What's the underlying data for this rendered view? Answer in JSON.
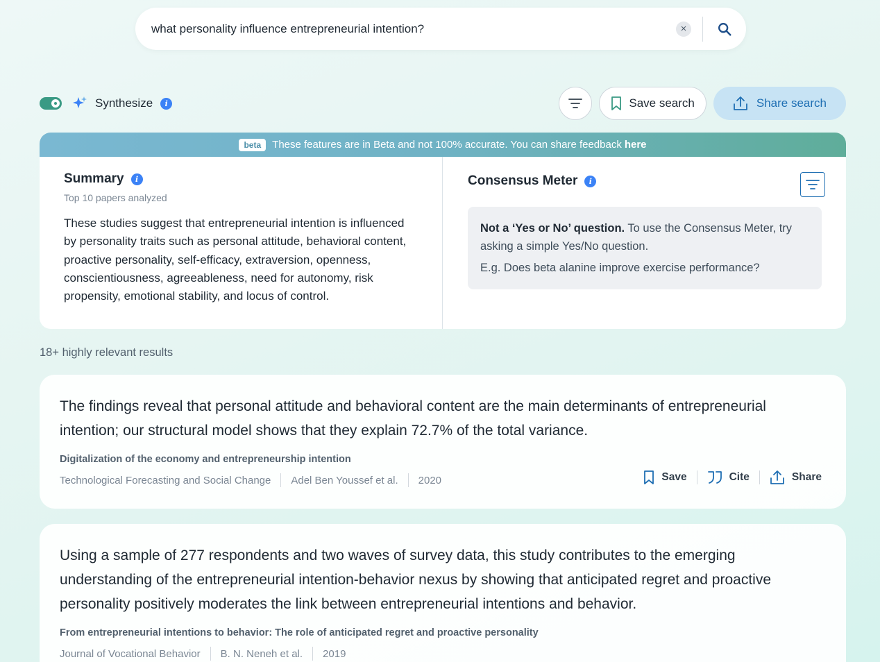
{
  "search": {
    "query": "what personality influence entrepreneurial intention?",
    "clear_glyph": "×"
  },
  "toolbar": {
    "synthesize_label": "Synthesize",
    "save_search_label": "Save search",
    "share_search_label": "Share search",
    "toggle_on": true
  },
  "beta": {
    "pill": "beta",
    "message": "These features are in Beta and not 100% accurate. You can share feedback",
    "link": "here"
  },
  "summary": {
    "title": "Summary",
    "subtitle": "Top 10 papers analyzed",
    "text": "These studies suggest that entrepreneurial intention is influenced by personality traits such as personal attitude, behavioral content, proactive personality, self-efficacy, extraversion, openness, conscientiousness, agreeableness, need for autonomy, risk propensity, emotional stability, and locus of control."
  },
  "consensus": {
    "title": "Consensus Meter",
    "bold": "Not a ‘Yes or No’ question.",
    "message": " To use the Consensus Meter, try asking a simple Yes/No question.",
    "example": "E.g. Does beta alanine improve exercise performance?"
  },
  "results": {
    "count_label": "18+ highly relevant results",
    "actions": {
      "save": "Save",
      "cite": "Cite",
      "share": "Share"
    },
    "items": [
      {
        "claim": "The findings reveal that personal attitude and behavioral content are the main determinants of entrepreneurial intention; our structural model shows that they explain 72.7% of the total variance.",
        "title": "Digitalization of the economy and entrepreneurship intention",
        "journal": "Technological Forecasting and Social Change",
        "authors": "Adel Ben Youssef et al.",
        "year": "2020"
      },
      {
        "claim": "Using a sample of 277 respondents and two waves of survey data, this study contributes to the emerging understanding of the entrepreneurial intention-behavior nexus by showing that anticipated regret and proactive personality positively moderates the link between entrepreneurial intentions and behavior.",
        "title": "From entrepreneurial intentions to behavior: The role of anticipated regret and proactive personality",
        "journal": "Journal of Vocational Behavior",
        "authors": "B. N. Neneh et al.",
        "year": "2019"
      }
    ]
  },
  "icons": {
    "info": "i",
    "accent_color": "#3b82f6",
    "brand_color": "#1f6fb3",
    "toggle_color": "#3a9a84"
  }
}
